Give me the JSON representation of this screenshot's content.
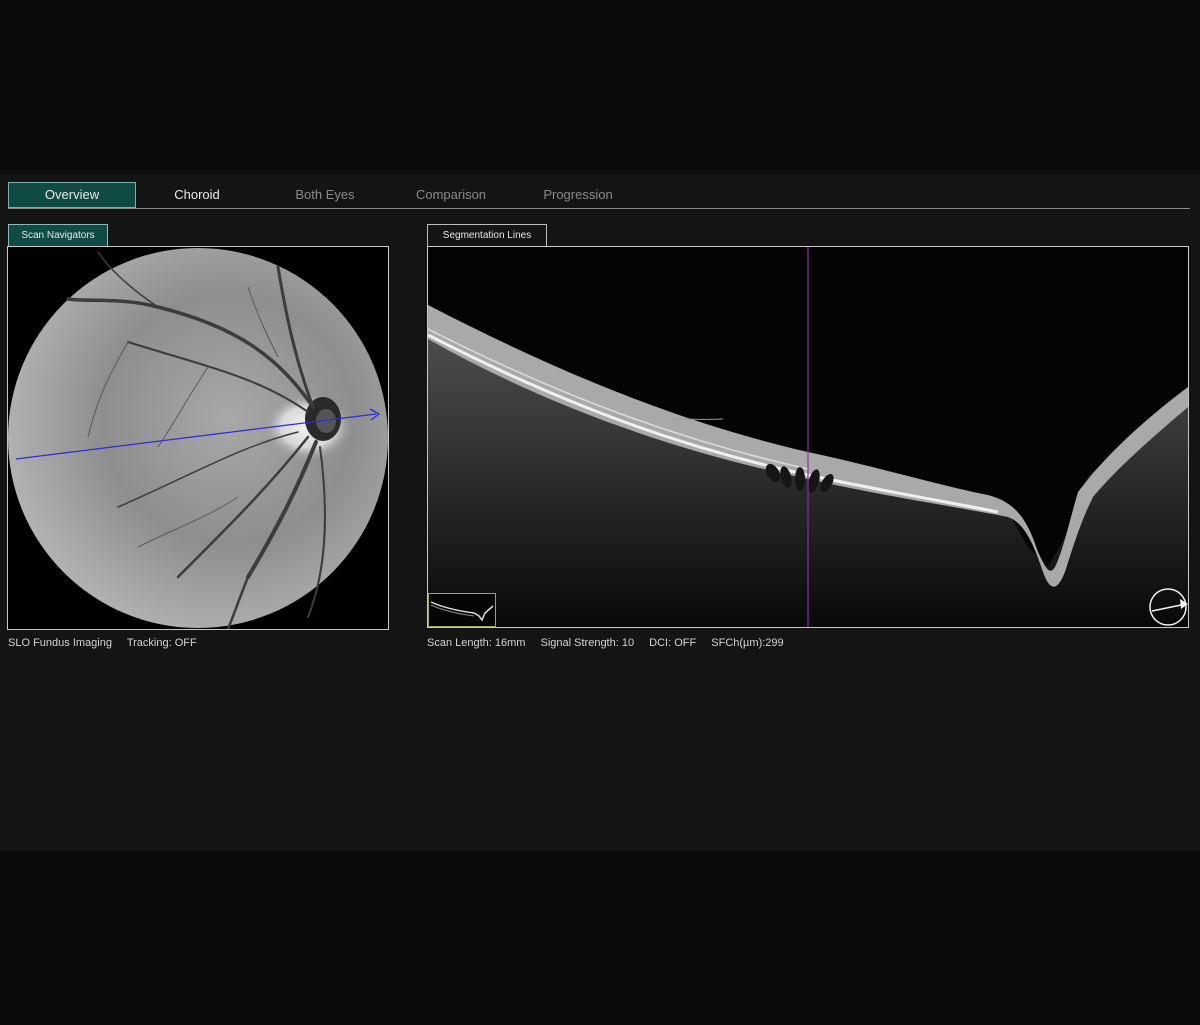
{
  "tabs": [
    {
      "label": "Overview",
      "state": "active"
    },
    {
      "label": "Choroid",
      "state": "enabled"
    },
    {
      "label": "Both Eyes",
      "state": "disabled"
    },
    {
      "label": "Comparison",
      "state": "disabled"
    },
    {
      "label": "Progression",
      "state": "disabled"
    }
  ],
  "left_panel": {
    "tab_label": "Scan Navigators",
    "caption": {
      "imaging": "SLO Fundus Imaging",
      "tracking": "Tracking: OFF"
    }
  },
  "right_panel": {
    "tab_label": "Segmentation Lines",
    "caption": {
      "scan_length": "Scan Length: 16mm",
      "signal_strength": "Signal Strength: 10",
      "dci": "DCI: OFF",
      "sfch": "SFCh(µm):299"
    }
  },
  "colors": {
    "accent": "#0f4a44",
    "scan_line": "#2c2cdc",
    "marker_line": "#8a2fb0"
  },
  "icons": [
    "scan-direction-arrow-icon",
    "oct-thumbnail"
  ]
}
